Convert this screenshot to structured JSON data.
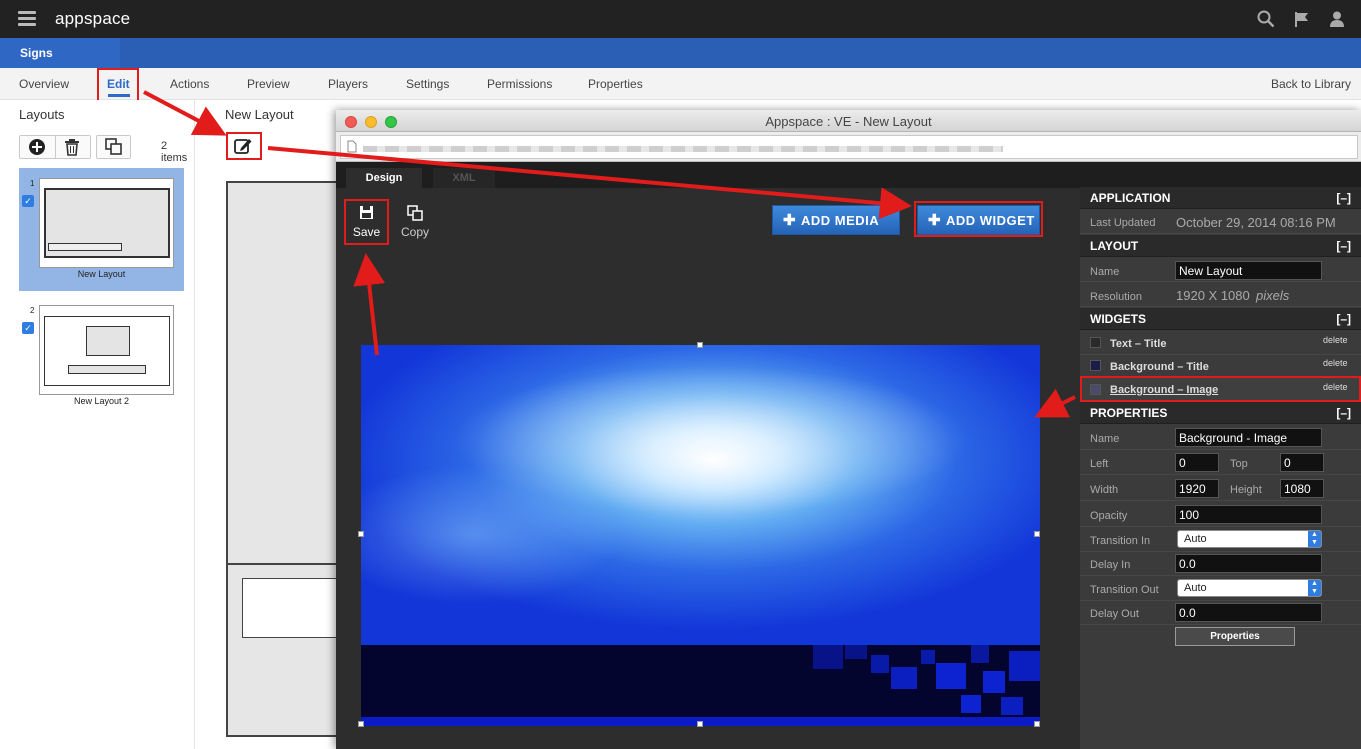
{
  "app": {
    "name": "appspace"
  },
  "signs_tab": "Signs",
  "nav": {
    "tabs": [
      "Overview",
      "Edit",
      "Actions",
      "Preview",
      "Players",
      "Settings",
      "Permissions",
      "Properties"
    ],
    "active": "Edit",
    "back": "Back to Library"
  },
  "left_panel": {
    "title": "Layouts",
    "count": "2 items",
    "layouts": [
      {
        "index": "1",
        "name": "New Layout",
        "selected": true
      },
      {
        "index": "2",
        "name": "New Layout 2",
        "selected": false
      }
    ]
  },
  "middle": {
    "title": "New Layout"
  },
  "ve_window": {
    "title": "Appspace : VE - New Layout",
    "tabs": [
      "Design",
      "XML"
    ],
    "toolbar": {
      "save": "Save",
      "copy": "Copy"
    },
    "add_media": "ADD MEDIA",
    "add_widget": "ADD WIDGET"
  },
  "right_panel": {
    "application": {
      "header": "APPLICATION",
      "toggle": "[–]",
      "last_updated_label": "Last Updated",
      "last_updated_value": "October 29, 2014 08:16 PM"
    },
    "layout": {
      "header": "LAYOUT",
      "toggle": "[–]",
      "name_label": "Name",
      "name_value": "New Layout",
      "resolution_label": "Resolution",
      "resolution_value": "1920 X 1080",
      "resolution_unit": "pixels"
    },
    "widgets": {
      "header": "WIDGETS",
      "toggle": "[–]",
      "items": [
        {
          "name": "Text – Title",
          "color": "#2a2a2a",
          "delete": "delete"
        },
        {
          "name": "Background – Title",
          "color": "#1c1c4a",
          "delete": "delete"
        },
        {
          "name": "Background – Image",
          "color": "#4a4a6a",
          "delete": "delete",
          "selected": true
        }
      ]
    },
    "properties": {
      "header": "PROPERTIES",
      "toggle": "[–]",
      "name_label": "Name",
      "name_value": "Background - Image",
      "left_label": "Left",
      "left_value": "0",
      "top_label": "Top",
      "top_value": "0",
      "width_label": "Width",
      "width_value": "1920",
      "height_label": "Height",
      "height_value": "1080",
      "opacity_label": "Opacity",
      "opacity_value": "100",
      "transition_in_label": "Transition In",
      "transition_in_value": "Auto",
      "delay_in_label": "Delay In",
      "delay_in_value": "0.0",
      "transition_out_label": "Transition Out",
      "transition_out_value": "Auto",
      "delay_out_label": "Delay Out",
      "delay_out_value": "0.0",
      "button": "Properties"
    }
  },
  "colors": {
    "accent": "#2e6bc9",
    "top_bar": "#222222",
    "signs_bar": "#2a5fb5",
    "annotation": "#e21b1b"
  }
}
